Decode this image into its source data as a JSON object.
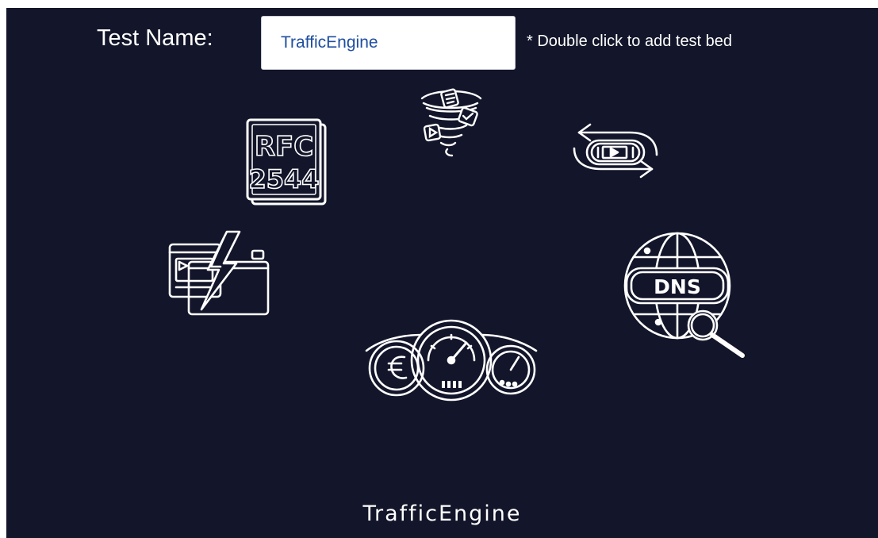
{
  "header": {
    "test_name_label": "Test Name:",
    "test_name_value": "TrafficEngine",
    "hint": "* Double click to add test bed"
  },
  "tiles": [
    {
      "icon": "rfc2544-icon",
      "line1": "RFC",
      "line2": "2544"
    },
    {
      "icon": "tornado-media-icon"
    },
    {
      "icon": "video-loop-icon"
    },
    {
      "icon": "video-burst-icon"
    },
    {
      "icon": "dns-lookup-icon",
      "label": "DNS"
    },
    {
      "icon": "dashboard-gauges-icon"
    }
  ],
  "footer": {
    "title": "TrafficEngine"
  },
  "colors": {
    "background": "#13162a",
    "foreground": "#ffffff",
    "input_text": "#1f4ea0"
  }
}
